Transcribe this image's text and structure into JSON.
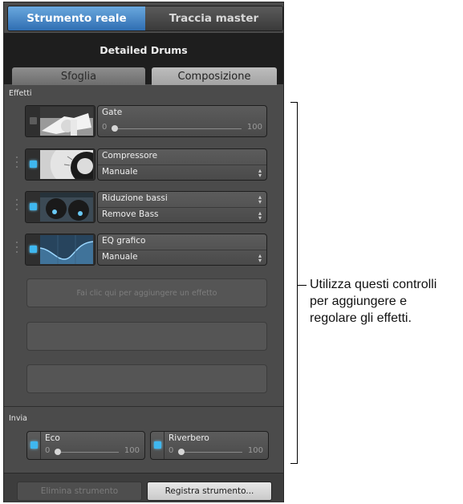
{
  "tabs": [
    {
      "label": "Strumento reale",
      "active": true
    },
    {
      "label": "Traccia master",
      "active": false
    }
  ],
  "header": {
    "title": "Detailed Drums"
  },
  "subtabs": [
    {
      "label": "Sfoglia",
      "active": false
    },
    {
      "label": "Composizione",
      "active": true
    }
  ],
  "effects": {
    "section_label": "Effetti",
    "items": [
      {
        "name": "Gate",
        "type": "slider",
        "min": "0",
        "max": "100",
        "value": 0,
        "enabled": false,
        "icon": "gate-thumbnail-icon"
      },
      {
        "name": "Compressore",
        "type": "preset",
        "preset": "Manuale",
        "enabled": true,
        "icon": "compressor-thumbnail-icon"
      },
      {
        "name": "Riduzione bassi",
        "type": "preset",
        "preset": "Remove Bass",
        "enabled": true,
        "icon": "bass-reduction-thumbnail-icon"
      },
      {
        "name": "EQ grafico",
        "type": "preset",
        "preset": "Manuale",
        "enabled": true,
        "icon": "eq-thumbnail-icon"
      }
    ],
    "add_placeholder": "Fai clic qui per aggiungere un effetto"
  },
  "sends": {
    "section_label": "Invia",
    "items": [
      {
        "name": "Eco",
        "min": "0",
        "max": "100",
        "value": 0
      },
      {
        "name": "Riverbero",
        "min": "0",
        "max": "100",
        "value": 0
      }
    ]
  },
  "footer": {
    "delete_label": "Elimina strumento",
    "save_label": "Registra strumento..."
  },
  "callout": {
    "line1": "Utilizza questi controlli",
    "line2": "per aggiungere e",
    "line3": "regolare gli effetti."
  },
  "colors": {
    "accent": "#3a82c8",
    "led": "#3fb7ef",
    "panel": "#4b4b4b"
  }
}
